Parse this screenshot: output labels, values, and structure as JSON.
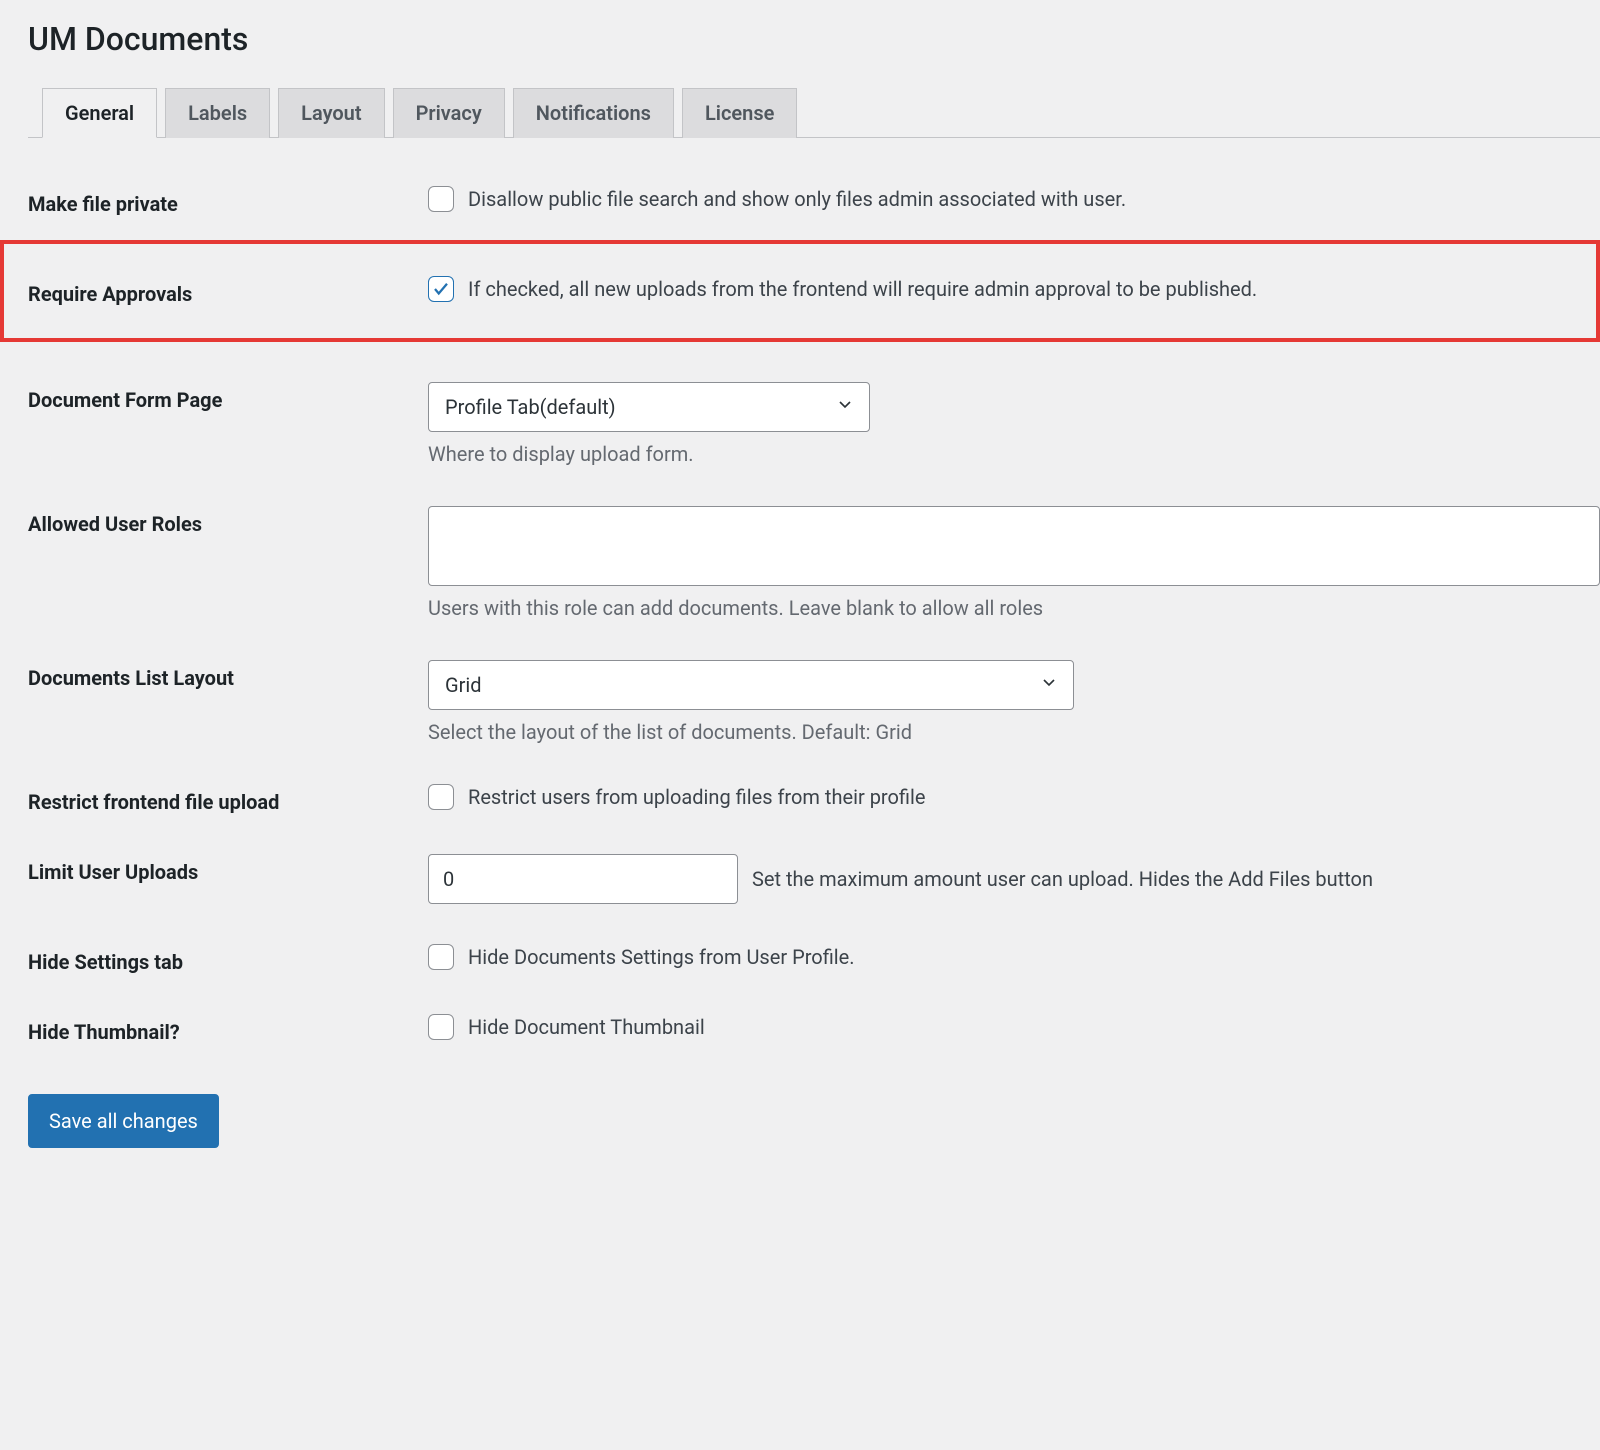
{
  "page": {
    "title": "UM Documents"
  },
  "tabs": {
    "general": "General",
    "labels": "Labels",
    "layout": "Layout",
    "privacy": "Privacy",
    "notifications": "Notifications",
    "license": "License"
  },
  "fields": {
    "make_private": {
      "label": "Make file private",
      "desc": "Disallow public file search and show only files admin associated with user."
    },
    "require_approvals": {
      "label": "Require Approvals",
      "desc": "If checked, all new uploads from the frontend will require admin approval to be published."
    },
    "form_page": {
      "label": "Document Form Page",
      "value": "Profile Tab(default)",
      "help": "Where to display upload form."
    },
    "allowed_roles": {
      "label": "Allowed User Roles",
      "help": "Users with this role can add documents. Leave blank to allow all roles"
    },
    "list_layout": {
      "label": "Documents List Layout",
      "value": "Grid",
      "help": "Select the layout of the list of documents. Default: Grid"
    },
    "restrict_upload": {
      "label": "Restrict frontend file upload",
      "desc": "Restrict users from uploading files from their profile"
    },
    "limit_uploads": {
      "label": "Limit User Uploads",
      "value": "0",
      "desc": "Set the maximum amount user can upload. Hides the Add Files button"
    },
    "hide_settings": {
      "label": "Hide Settings tab",
      "desc": "Hide Documents Settings from User Profile."
    },
    "hide_thumbnail": {
      "label": "Hide Thumbnail?",
      "desc": "Hide Document Thumbnail"
    }
  },
  "buttons": {
    "save": "Save all changes"
  }
}
